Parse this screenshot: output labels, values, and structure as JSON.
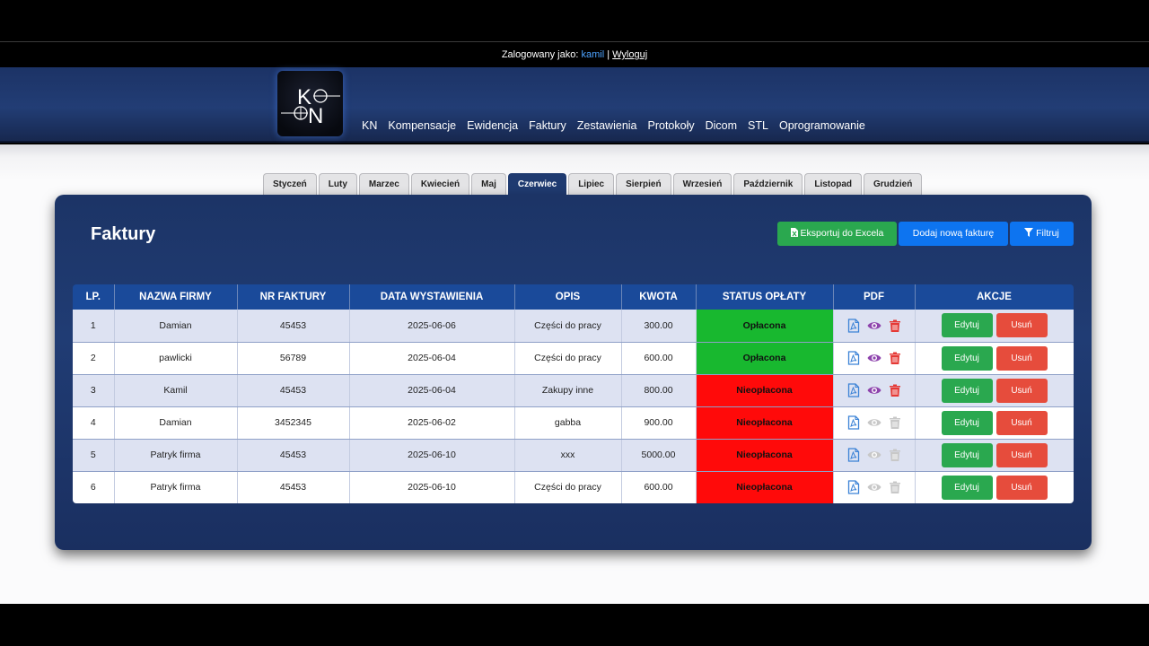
{
  "login": {
    "prefix": "Zalogowany jako:",
    "user": "kamil",
    "separator": "|",
    "logout": "Wyloguj"
  },
  "logo_text": "KN",
  "nav": [
    "KN",
    "Kompensacje",
    "Ewidencja",
    "Faktury",
    "Zestawienia",
    "Protokoły",
    "Dicom",
    "STL",
    "Oprogramowanie"
  ],
  "months": [
    "Styczeń",
    "Luty",
    "Marzec",
    "Kwiecień",
    "Maj",
    "Czerwiec",
    "Lipiec",
    "Sierpień",
    "Wrzesień",
    "Październik",
    "Listopad",
    "Grudzień"
  ],
  "active_month": "Czerwiec",
  "panel": {
    "title": "Faktury",
    "export_label": "Eksportuj do Excela",
    "add_label": "Dodaj nową fakturę",
    "filter_label": "Filtruj"
  },
  "table": {
    "headers": [
      "LP.",
      "NAZWA FIRMY",
      "NR FAKTURY",
      "DATA WYSTAWIENIA",
      "OPIS",
      "KWOTA",
      "STATUS OPŁATY",
      "PDF",
      "AKCJE"
    ],
    "rows": [
      {
        "lp": "1",
        "firm": "Damian",
        "nr": "45453",
        "date": "2025-06-06",
        "desc": "Części do pracy",
        "amount": "300.00",
        "status": "Opłacona",
        "paid": true,
        "pdf_active": true,
        "edit": "Edytuj",
        "delete": "Usuń"
      },
      {
        "lp": "2",
        "firm": "pawlicki",
        "nr": "56789",
        "date": "2025-06-04",
        "desc": "Części do pracy",
        "amount": "600.00",
        "status": "Opłacona",
        "paid": true,
        "pdf_active": true,
        "edit": "Edytuj",
        "delete": "Usuń"
      },
      {
        "lp": "3",
        "firm": "Kamil",
        "nr": "45453",
        "date": "2025-06-04",
        "desc": "Zakupy inne",
        "amount": "800.00",
        "status": "Nieopłacona",
        "paid": false,
        "pdf_active": true,
        "edit": "Edytuj",
        "delete": "Usuń"
      },
      {
        "lp": "4",
        "firm": "Damian",
        "nr": "3452345",
        "date": "2025-06-02",
        "desc": "gabba",
        "amount": "900.00",
        "status": "Nieopłacona",
        "paid": false,
        "pdf_active": false,
        "edit": "Edytuj",
        "delete": "Usuń"
      },
      {
        "lp": "5",
        "firm": "Patryk firma",
        "nr": "45453",
        "date": "2025-06-10",
        "desc": "xxx",
        "amount": "5000.00",
        "status": "Nieopłacona",
        "paid": false,
        "pdf_active": false,
        "edit": "Edytuj",
        "delete": "Usuń"
      },
      {
        "lp": "6",
        "firm": "Patryk firma",
        "nr": "45453",
        "date": "2025-06-10",
        "desc": "Części do pracy",
        "amount": "600.00",
        "status": "Nieopłacona",
        "paid": false,
        "pdf_active": false,
        "edit": "Edytuj",
        "delete": "Usuń"
      }
    ]
  },
  "colors": {
    "paid": "#18b82f",
    "unpaid": "#ff0a0a",
    "header_bg": "#1a4a9a",
    "edit": "#2aa84f",
    "delete": "#e64c3c",
    "primary": "#0d74f0",
    "pdf_icon": "#3b82d6",
    "view_icon": "#8e44ad",
    "trash_icon": "#e53935",
    "disabled_icon": "#c8c8c8"
  },
  "icons": {
    "pdf": "file-pdf-icon",
    "view": "eye-icon",
    "delete": "trash-icon",
    "excel": "file-excel-icon",
    "filter": "filter-icon"
  }
}
